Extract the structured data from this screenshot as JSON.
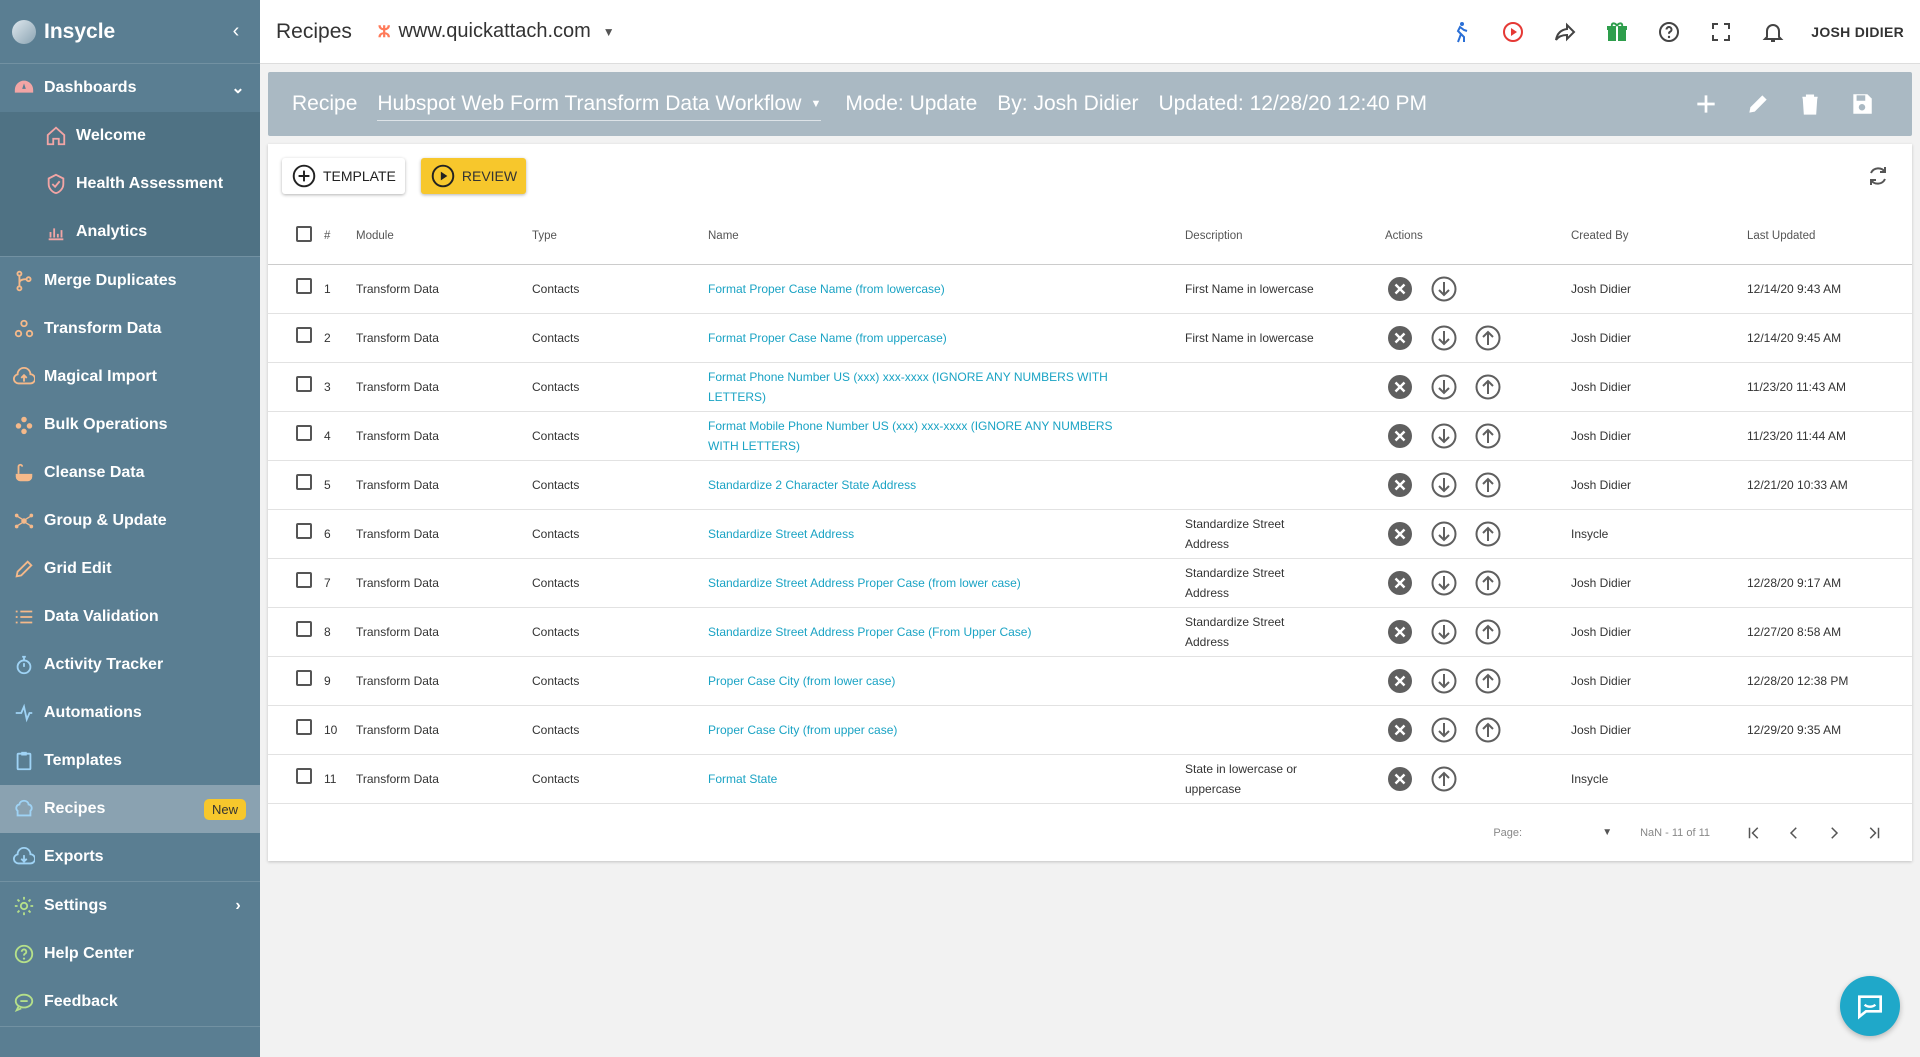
{
  "sidebar": {
    "brand": "Insycle",
    "dashboards": {
      "label": "Dashboards",
      "children": [
        "Welcome",
        "Health Assessment",
        "Analytics"
      ]
    },
    "items": [
      {
        "label": "Merge Duplicates",
        "icon": "merge-icon"
      },
      {
        "label": "Transform Data",
        "icon": "transform-icon"
      },
      {
        "label": "Magical Import",
        "icon": "cloud-upload-icon"
      },
      {
        "label": "Bulk Operations",
        "icon": "bulk-icon"
      },
      {
        "label": "Cleanse Data",
        "icon": "cleanse-icon"
      },
      {
        "label": "Group & Update",
        "icon": "group-icon"
      },
      {
        "label": "Grid Edit",
        "icon": "pencil-icon"
      },
      {
        "label": "Data Validation",
        "icon": "list-check-icon"
      },
      {
        "label": "Activity Tracker",
        "icon": "stopwatch-icon"
      },
      {
        "label": "Automations",
        "icon": "automation-icon"
      },
      {
        "label": "Templates",
        "icon": "clipboard-icon"
      },
      {
        "label": "Recipes",
        "icon": "recipe-icon",
        "badge": "New"
      },
      {
        "label": "Exports",
        "icon": "cloud-download-icon"
      },
      {
        "label": "Settings",
        "icon": "gear-icon"
      },
      {
        "label": "Help Center",
        "icon": "help-icon"
      },
      {
        "label": "Feedback",
        "icon": "chat-bubble-icon"
      }
    ]
  },
  "topbar": {
    "title": "Recipes",
    "portal": "www.quickattach.com",
    "user": "JOSH DIDIER"
  },
  "recipe": {
    "label": "Recipe",
    "selected": "Hubspot Web Form Transform Data Workflow",
    "mode": "Mode: Update",
    "by": "By: Josh Didier",
    "updated": "Updated: 12/28/20 12:40 PM"
  },
  "toolbar": {
    "template_label": "TEMPLATE",
    "review_label": "REVIEW"
  },
  "table": {
    "headers": [
      "#",
      "Module",
      "Type",
      "Name",
      "Description",
      "Actions",
      "Created By",
      "Last Updated"
    ],
    "rows": [
      {
        "num": "1",
        "module": "Transform Data",
        "type": "Contacts",
        "name": "Format Proper Case Name (from lowercase)",
        "description": "First Name in lowercase",
        "actions": [
          "remove",
          "down"
        ],
        "created_by": "Josh Didier",
        "updated": "12/14/20 9:43 AM"
      },
      {
        "num": "2",
        "module": "Transform Data",
        "type": "Contacts",
        "name": "Format Proper Case Name (from uppercase)",
        "description": "First Name in lowercase",
        "actions": [
          "remove",
          "down",
          "up"
        ],
        "created_by": "Josh Didier",
        "updated": "12/14/20 9:45 AM"
      },
      {
        "num": "3",
        "module": "Transform Data",
        "type": "Contacts",
        "name": "Format Phone Number US (xxx) xxx-xxxx (IGNORE ANY NUMBERS WITH LETTERS)",
        "description": "",
        "actions": [
          "remove",
          "down",
          "up"
        ],
        "created_by": "Josh Didier",
        "updated": "11/23/20 11:43 AM"
      },
      {
        "num": "4",
        "module": "Transform Data",
        "type": "Contacts",
        "name": "Format Mobile Phone Number US (xxx) xxx-xxxx (IGNORE ANY NUMBERS WITH LETTERS)",
        "description": "",
        "actions": [
          "remove",
          "down",
          "up"
        ],
        "created_by": "Josh Didier",
        "updated": "11/23/20 11:44 AM"
      },
      {
        "num": "5",
        "module": "Transform Data",
        "type": "Contacts",
        "name": "Standardize 2 Character State Address",
        "description": "",
        "actions": [
          "remove",
          "down",
          "up"
        ],
        "created_by": "Josh Didier",
        "updated": "12/21/20 10:33 AM"
      },
      {
        "num": "6",
        "module": "Transform Data",
        "type": "Contacts",
        "name": "Standardize Street Address",
        "description": "Standardize Street Address",
        "actions": [
          "remove",
          "down",
          "up"
        ],
        "created_by": "Insycle",
        "updated": ""
      },
      {
        "num": "7",
        "module": "Transform Data",
        "type": "Contacts",
        "name": "Standardize Street Address Proper Case (from lower case)",
        "description": "Standardize Street Address",
        "actions": [
          "remove",
          "down",
          "up"
        ],
        "created_by": "Josh Didier",
        "updated": "12/28/20 9:17 AM"
      },
      {
        "num": "8",
        "module": "Transform Data",
        "type": "Contacts",
        "name": "Standardize Street Address Proper Case (From Upper Case)",
        "description": "Standardize Street Address",
        "actions": [
          "remove",
          "down",
          "up"
        ],
        "created_by": "Josh Didier",
        "updated": "12/27/20 8:58 AM"
      },
      {
        "num": "9",
        "module": "Transform Data",
        "type": "Contacts",
        "name": "Proper Case City (from lower case)",
        "description": "",
        "actions": [
          "remove",
          "down",
          "up"
        ],
        "created_by": "Josh Didier",
        "updated": "12/28/20 12:38 PM"
      },
      {
        "num": "10",
        "module": "Transform Data",
        "type": "Contacts",
        "name": "Proper Case City (from upper case)",
        "description": "",
        "actions": [
          "remove",
          "down",
          "up"
        ],
        "created_by": "Josh Didier",
        "updated": "12/29/20 9:35 AM"
      },
      {
        "num": "11",
        "module": "Transform Data",
        "type": "Contacts",
        "name": "Format State",
        "description": "State in lowercase or uppercase",
        "actions": [
          "remove",
          "up"
        ],
        "created_by": "Insycle",
        "updated": ""
      }
    ]
  },
  "pager": {
    "page_label": "Page:",
    "range": "NaN - 11 of 11"
  },
  "colors": {
    "sidebar": "#5a7e92",
    "recipe_bar": "#aab9c3",
    "link": "#1aa3c4",
    "review_button": "#f7c72c",
    "chat_button": "#1fa8c9"
  }
}
